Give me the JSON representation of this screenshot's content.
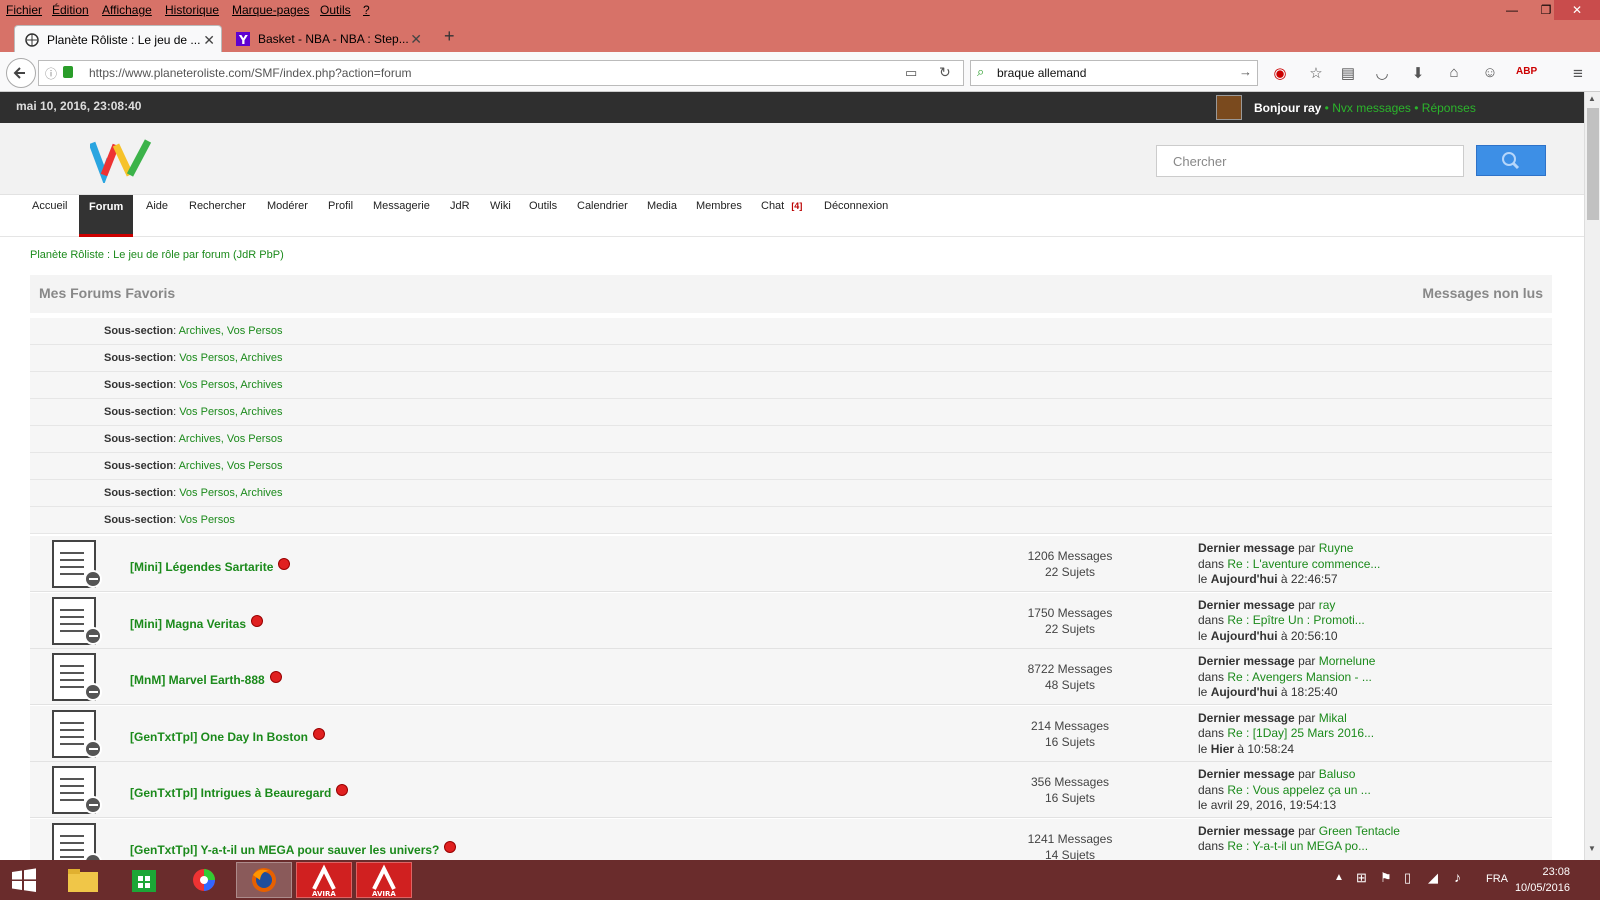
{
  "menubar": {
    "items": [
      "Fichier",
      "Édition",
      "Affichage",
      "Historique",
      "Marque-pages",
      "Outils",
      "?"
    ]
  },
  "tabs": [
    {
      "label": "Planète Rôliste : Le jeu de ..."
    },
    {
      "label": "Basket - NBA - NBA : Step..."
    }
  ],
  "nav": {
    "url": "https://www.planeteroliste.com/SMF/index.php?action=forum",
    "search_value": "braque allemand"
  },
  "site": {
    "date": "mai 10, 2016, 23:08:40",
    "greet_name": "Bonjour ray",
    "sep1": " • ",
    "new_msgs": "Nvx messages",
    "sep2": " • ",
    "replies": "Réponses",
    "search_placeholder": "Chercher"
  },
  "menu": {
    "items": [
      "Accueil",
      "Forum",
      "Aide",
      "Rechercher",
      "Modérer",
      "Profil",
      "Messagerie",
      "JdR",
      "Wiki",
      "Outils",
      "Calendrier",
      "Media",
      "Membres",
      "Chat",
      "Déconnexion"
    ],
    "chat_badge": "[4]"
  },
  "breadcrumb": "Planète Rôliste : Le jeu de rôle par forum (JdR PbP)",
  "favorites": {
    "title": "Mes Forums Favoris",
    "unread": "Messages non lus"
  },
  "subsections": [
    {
      "label": "Sous-section",
      "links": "Archives, Vos Persos"
    },
    {
      "label": "Sous-section",
      "links": "Vos Persos, Archives"
    },
    {
      "label": "Sous-section",
      "links": "Vos Persos, Archives"
    },
    {
      "label": "Sous-section",
      "links": "Vos Persos, Archives"
    },
    {
      "label": "Sous-section",
      "links": "Archives, Vos Persos"
    },
    {
      "label": "Sous-section",
      "links": "Archives, Vos Persos"
    },
    {
      "label": "Sous-section",
      "links": "Vos Persos, Archives"
    },
    {
      "label": "Sous-section",
      "links": "Vos Persos"
    }
  ],
  "boards": [
    {
      "name": "[Mini] Légendes Sartarite",
      "messages": "1206 Messages",
      "topics": "22 Sujets",
      "last_by": "Ruyne",
      "last_topic": "Re : L'aventure commence...",
      "day": "Aujourd'hui",
      "time": "à 22:46:57"
    },
    {
      "name": "[Mini] Magna Veritas",
      "messages": "1750 Messages",
      "topics": "22 Sujets",
      "last_by": "ray",
      "last_topic": "Re : Epître Un : Promoti...",
      "day": "Aujourd'hui",
      "time": "à 20:56:10"
    },
    {
      "name": "[MnM] Marvel Earth-888",
      "messages": "8722 Messages",
      "topics": "48 Sujets",
      "last_by": "Mornelune",
      "last_topic": "Re : Avengers Mansion - ...",
      "day": "Aujourd'hui",
      "time": "à 18:25:40"
    },
    {
      "name": "[GenTxtTpl] One Day In Boston",
      "messages": "214 Messages",
      "topics": "16 Sujets",
      "last_by": "Mikal",
      "last_topic": "Re : [1Day] 25 Mars 2016...",
      "day": "Hier",
      "time": "à 10:58:24"
    },
    {
      "name": "[GenTxtTpl] Intrigues à Beauregard",
      "messages": "356 Messages",
      "topics": "16 Sujets",
      "last_by": "Baluso",
      "last_topic": "Re : Vous appelez ça un ...",
      "day": "",
      "time": "avril 29, 2016, 19:54:13"
    },
    {
      "name": "[GenTxtTpl] Y-a-t-il un MEGA pour sauver les univers?",
      "messages": "1241 Messages",
      "topics": "14 Sujets",
      "last_by": "Green Tentacle",
      "last_topic": "Re : Y-a-t-il un MEGA po...",
      "day": "",
      "time": ""
    }
  ],
  "labels": {
    "last_message": "Dernier message",
    "by": " par ",
    "in": "dans ",
    "le": "le "
  },
  "taskbar": {
    "time": "23:08",
    "date": "10/05/2016",
    "lang": "FRA"
  }
}
